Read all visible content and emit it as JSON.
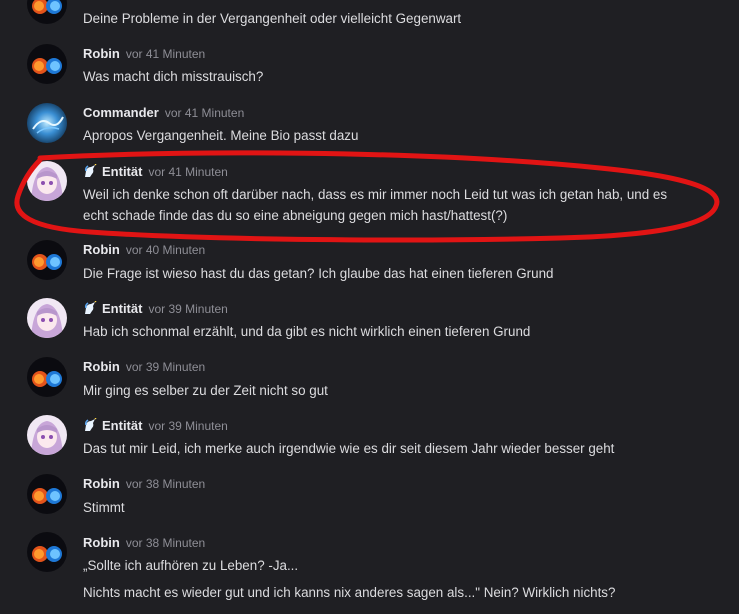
{
  "messages": [
    {
      "author": "",
      "time": "",
      "lines": [
        "Deine Probleme in der Vergangenheit oder vielleicht Gegenwart"
      ],
      "avatar": "fire-ice-avatar"
    },
    {
      "author": "Robin",
      "time": "vor 41 Minuten",
      "lines": [
        "Was macht dich misstrauisch?"
      ],
      "avatar": "fire-ice-avatar"
    },
    {
      "author": "Commander",
      "time": "vor 41 Minuten",
      "lines": [
        "Apropos Vergangenheit. Meine Bio passt dazu"
      ],
      "avatar": "blue-dragon-avatar"
    },
    {
      "author": "Entität",
      "time": "vor 41 Minuten",
      "lines": [
        "Weil ich denke schon oft darüber nach, dass es mir immer noch Leid tut was ich getan hab, und es",
        "echt schade finde das du so eine abneigung gegen mich hast/hattest(?)"
      ],
      "avatar": "anime-girl-avatar",
      "badge": "unicorn-icon"
    },
    {
      "author": "Robin",
      "time": "vor 40 Minuten",
      "lines": [
        "Die Frage ist wieso hast du das getan? Ich glaube das hat einen tieferen Grund"
      ],
      "avatar": "fire-ice-avatar"
    },
    {
      "author": "Entität",
      "time": "vor 39 Minuten",
      "lines": [
        "Hab ich schonmal erzählt, und da gibt es nicht wirklich einen tieferen Grund"
      ],
      "avatar": "anime-girl-avatar",
      "badge": "unicorn-icon"
    },
    {
      "author": "Robin",
      "time": "vor 39 Minuten",
      "lines": [
        "Mir ging es selber zu der Zeit nicht so gut"
      ],
      "avatar": "fire-ice-avatar"
    },
    {
      "author": "Entität",
      "time": "vor 39 Minuten",
      "lines": [
        "Das tut mir Leid, ich merke auch irgendwie wie es dir seit diesem Jahr wieder besser geht"
      ],
      "avatar": "anime-girl-avatar",
      "badge": "unicorn-icon"
    },
    {
      "author": "Robin",
      "time": "vor 38 Minuten",
      "lines": [
        "Stimmt"
      ],
      "avatar": "fire-ice-avatar"
    },
    {
      "author": "Robin",
      "time": "vor 38 Minuten",
      "lines": [
        "„Sollte ich aufhören zu Leben? -Ja...",
        "Nichts macht es wieder gut und ich kanns nix anderes sagen als...\" Nein? Wirklich nichts?"
      ],
      "avatar": "fire-ice-avatar"
    }
  ],
  "colors": {
    "background": "#1f1f23",
    "annotation": "#e11414",
    "timestamp": "#8e8e96"
  }
}
